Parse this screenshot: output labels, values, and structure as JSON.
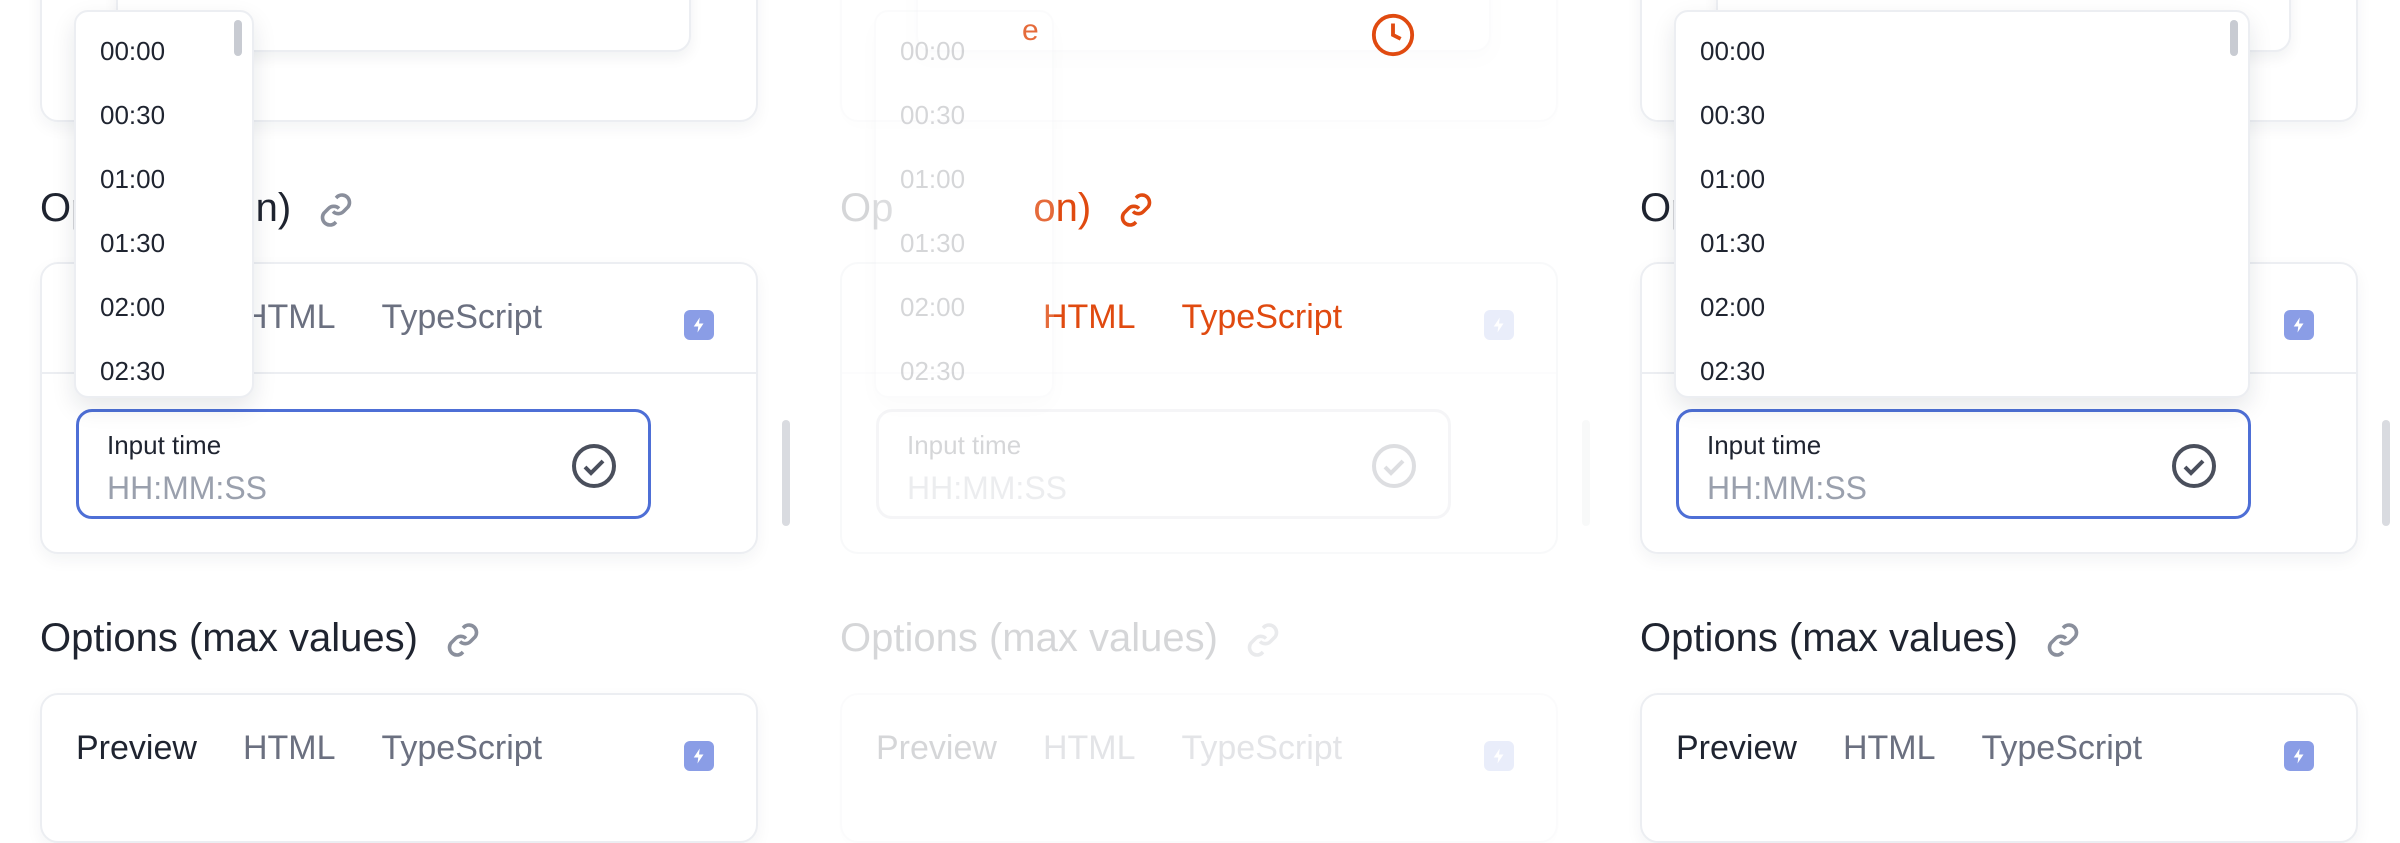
{
  "colors": {
    "focus_border": "#4e6fd6",
    "bolt_badge": "#8a9de6",
    "accent_orange": "#e04a10",
    "text_primary": "#1f2430",
    "text_muted": "#6b7080",
    "placeholder": "#9aa0ad"
  },
  "columns": [
    {
      "top_field_fragment": "e",
      "section1_title": "Options (12-hour format)",
      "section1_visible": "Op      on)",
      "tabs": [
        "Preview",
        "HTML",
        "TypeScript"
      ],
      "time_label": "Input time",
      "time_placeholder": "HH:MM:SS",
      "section2_title": "Options (max values)",
      "tabs2": [
        "Preview",
        "HTML",
        "TypeScript"
      ]
    }
  ],
  "section_titles": {
    "twelve_hour_left": "Op",
    "twelve_hour_right": "on)",
    "max_values": "Options (max values)"
  },
  "tabs": {
    "preview": "Preview",
    "html": "HTML",
    "typescript": "TypeScript"
  },
  "time_input": {
    "label": "Input time",
    "placeholder": "HH:MM:SS"
  },
  "top_field_fragment": "e",
  "dropdown_options": [
    "00:00",
    "00:30",
    "01:00",
    "01:30",
    "02:00",
    "02:30"
  ],
  "icons": {
    "clock": "clock-icon",
    "link": "link-icon",
    "bolt": "bolt-icon",
    "check": "check-circle-icon"
  }
}
